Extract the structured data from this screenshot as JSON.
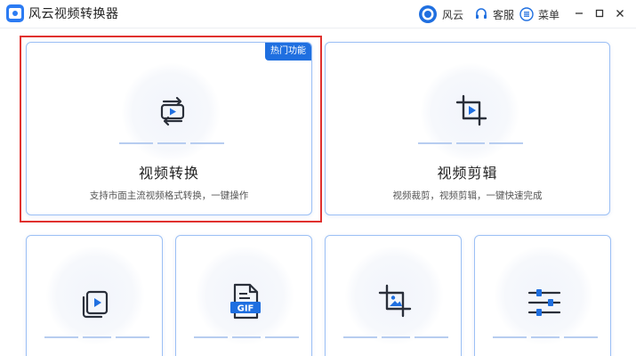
{
  "app": {
    "title": "风云视频转换器"
  },
  "toolbar": {
    "fengyun_label": "风云",
    "support_label": "客服",
    "menu_label": "菜单"
  },
  "badge": {
    "hot": "热门功能"
  },
  "cards": [
    {
      "title": "视频转换",
      "desc": "支持市面主流视频格式转换，一键操作"
    },
    {
      "title": "视频剪辑",
      "desc": "视频裁剪，视频剪辑，一键快速完成"
    }
  ],
  "small_cards": [
    {
      "icon": "video-stack-icon"
    },
    {
      "icon_text": "GIF"
    },
    {
      "icon": "image-crop-icon"
    },
    {
      "icon": "sliders-icon"
    }
  ],
  "colors": {
    "accent": "#1f6fe0",
    "card_border": "#9cc0f5",
    "highlight": "#e0312e",
    "icon_dark": "#2a2f3a"
  }
}
